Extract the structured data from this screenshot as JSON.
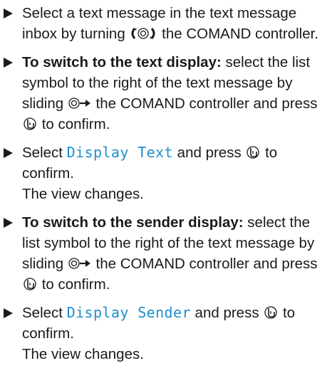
{
  "steps": [
    {
      "prefix": "Select a text message in the text message inbox by turning ",
      "suffix": " the COMAND controller."
    },
    {
      "bold": "To switch to the text display:",
      "text1": " select the list symbol to the right of the text message by sliding ",
      "text2": " the COMAND controller and press ",
      "text3": " to confirm."
    },
    {
      "text1": "Select ",
      "code": "Display Text",
      "text2": " and press ",
      "text3": " to confirm.",
      "result": "The view changes."
    },
    {
      "bold": "To switch to the sender display:",
      "text1": " select the list symbol to the right of the text message by sliding ",
      "text2": " the COMAND controller and press ",
      "text3": " to confirm."
    },
    {
      "text1": "Select ",
      "code": "Display Sender",
      "text2": " and press ",
      "text3": " to confirm.",
      "result": "The view changes."
    }
  ],
  "icons": {
    "turn": "controller-turn-icon",
    "slide": "controller-slide-right-icon",
    "press": "controller-press-icon"
  },
  "colors": {
    "code": "#1e8fd0",
    "text": "#1a1a1a"
  }
}
